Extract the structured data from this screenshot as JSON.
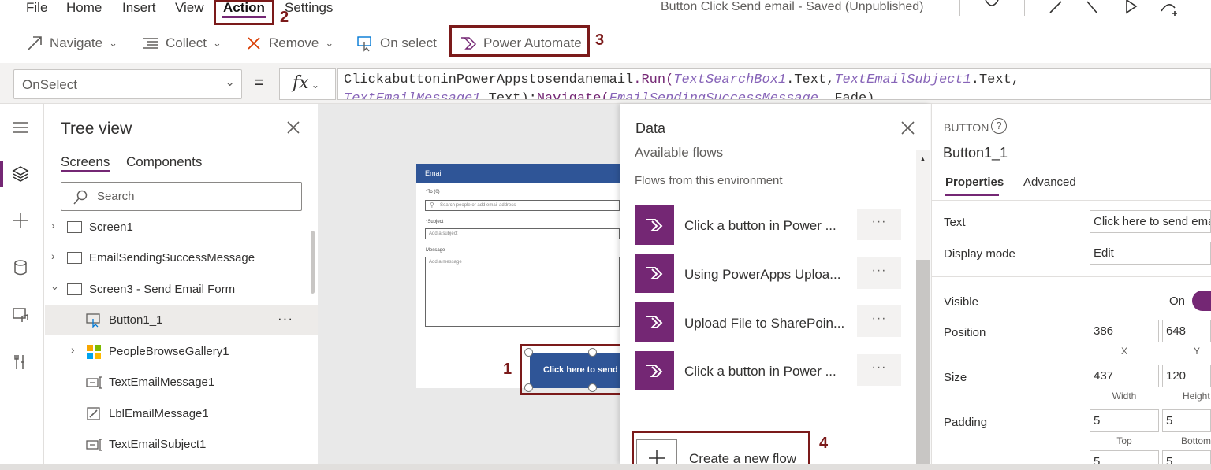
{
  "menu": {
    "items": [
      "File",
      "Home",
      "Insert",
      "View",
      "Action",
      "Settings"
    ],
    "active": "Action"
  },
  "doc_title": "Button Click Send email - Saved (Unpublished)",
  "toolbar": {
    "navigate": "Navigate",
    "collect": "Collect",
    "remove": "Remove",
    "on_select": "On select",
    "power_automate": "Power Automate"
  },
  "formula_bar": {
    "property": "OnSelect",
    "equals": "=",
    "fx": "fx",
    "line1": {
      "fn": "ClickabuttoninPowerAppstosendanemail",
      "run": ".Run(",
      "v1": "TextSearchBox1",
      "t1": ".Text,",
      "v2": "TextEmailSubject1",
      "t2": ".Text,"
    },
    "line2": {
      "v3": "TextEmailMessage1",
      "t3": ".Text);",
      "nav": "Navigate(",
      "v4": "EmailSendingSuccessMessage",
      "t4": ", Fade)"
    }
  },
  "tree_view": {
    "title": "Tree view",
    "tabs": [
      "Screens",
      "Components"
    ],
    "search_placeholder": "Search",
    "rows": [
      {
        "label": "Screen1"
      },
      {
        "label": "EmailSendingSuccessMessage"
      },
      {
        "label": "Screen3 - Send Email Form"
      },
      {
        "label": "Button1_1",
        "more": "···"
      },
      {
        "label": "PeopleBrowseGallery1"
      },
      {
        "label": "TextEmailMessage1"
      },
      {
        "label": "LblEmailMessage1"
      },
      {
        "label": "TextEmailSubject1"
      }
    ]
  },
  "canvas_app": {
    "header": "Email",
    "to_label": "*To (0)",
    "to_placeholder": "Search people or add email address",
    "subject_label": "*Subject",
    "subject_placeholder": "Add a subject",
    "message_label": "Message",
    "message_placeholder": "Add a message",
    "button_text": "Click here to send"
  },
  "callouts": [
    "1",
    "2",
    "3",
    "4"
  ],
  "data_panel": {
    "title": "Data",
    "section": "Available flows",
    "subsection": "Flows from this environment",
    "flows": [
      {
        "name": "Click a button in Power ...",
        "more": "···"
      },
      {
        "name": "Using PowerApps Uploa...",
        "more": "···"
      },
      {
        "name": "Upload File to SharePoin...",
        "more": "···"
      },
      {
        "name": "Click a button in Power ...",
        "more": "···"
      }
    ],
    "create": "Create a new flow"
  },
  "properties": {
    "control_type": "BUTTON",
    "control_name": "Button1_1",
    "tabs": [
      "Properties",
      "Advanced"
    ],
    "text_label": "Text",
    "text_value": "Click here to send ema",
    "display_mode_label": "Display mode",
    "display_mode_value": "Edit",
    "visible_label": "Visible",
    "visible_value": "On",
    "position_label": "Position",
    "x": "386",
    "y": "648",
    "x_label": "X",
    "y_label": "Y",
    "size_label": "Size",
    "width": "437",
    "height": "120",
    "width_label": "Width",
    "height_label": "Height",
    "padding_label": "Padding",
    "pad_top": "5",
    "pad_bottom": "5",
    "pad_top_label": "Top",
    "pad_bottom_label": "Bottom",
    "pad_left": "5",
    "pad_right": "5"
  },
  "colors": {
    "accent": "#742774",
    "callout": "#7b1a1a",
    "app_blue": "#2f5597"
  }
}
